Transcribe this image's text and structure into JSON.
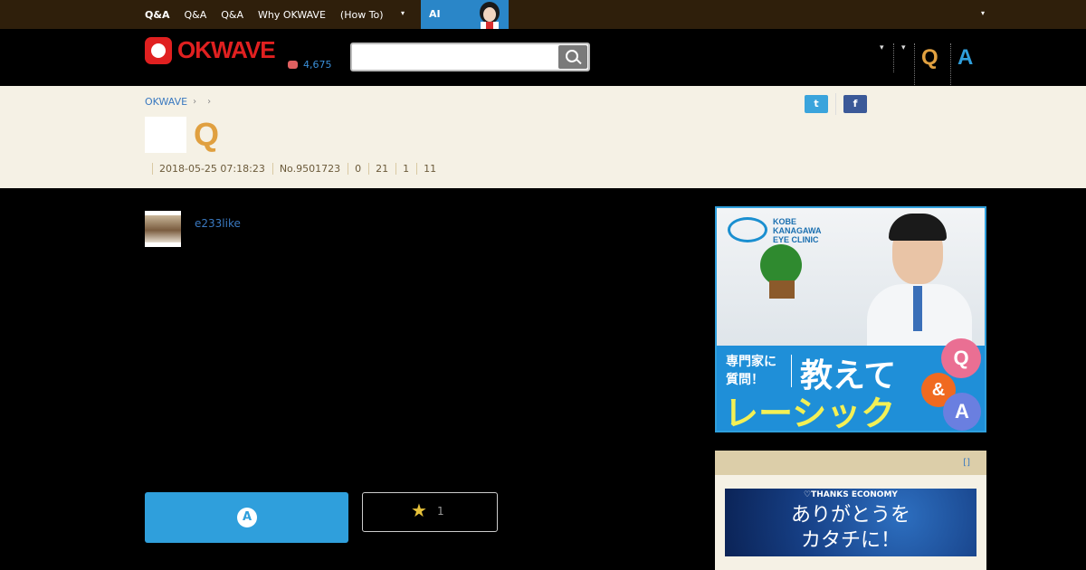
{
  "topbar": {
    "nav": [
      "Q&A",
      "Q&A",
      "Q&A",
      "Why OKWAVE",
      "(How To)"
    ],
    "caret": "▾",
    "ai_label": "AI",
    "right_caret": "▾"
  },
  "header": {
    "logo": "OKWAVE",
    "points": "4,675",
    "search_placeholder": "",
    "small_caret": "▾",
    "q_label": "Q",
    "a_label": "A"
  },
  "breadcrumb": {
    "home": "OKWAVE",
    "sep": "›"
  },
  "question": {
    "q_mark": "Q",
    "date": "2018-05-25 07:18:23",
    "number": "No.9501723",
    "stat1": "0",
    "stat2": "21",
    "stat3": "1",
    "stat4": "11"
  },
  "share": {
    "twitter": "t",
    "facebook": "f"
  },
  "author": {
    "name": "e233like"
  },
  "actions": {
    "answer_icon": "A",
    "star": "★",
    "fav_count": "1"
  },
  "ad1": {
    "clinic_name": "KOBE\nKANAGAWA\nEYE CLINIC",
    "small_l1": "専門家に",
    "small_l2": "質問！",
    "big1": "教えて",
    "big2": "レーシック",
    "bub_q": "Q",
    "bub_amp": "&",
    "bub_a": "A"
  },
  "ad2": {
    "link": "[]",
    "top_text": "♡THANKS ECONOMY",
    "line1": "ありがとうを",
    "line2": "カタチに！"
  },
  "colors": {
    "topbar": "#2f1f0b",
    "accent_blue": "#2f9fdc",
    "brand_red": "#e02020",
    "q_orange": "#e0a040"
  }
}
